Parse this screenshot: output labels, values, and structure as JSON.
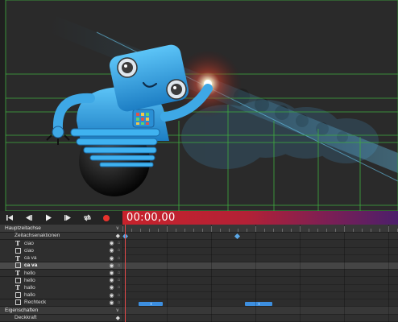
{
  "timecode": "00:00,00",
  "transport": {
    "buttons": [
      "skip-to-start",
      "step-back",
      "play",
      "step-forward",
      "loop",
      "record"
    ]
  },
  "layers_panel": {
    "main_section": "Hauptzeitachse",
    "actions_row": "Zeitachsenaktionen",
    "layers": [
      {
        "type": "text",
        "label": "ciao",
        "selected": false
      },
      {
        "type": "shape",
        "label": "ciao",
        "selected": false
      },
      {
        "type": "text",
        "label": "ca va",
        "selected": false
      },
      {
        "type": "shape",
        "label": "ca va",
        "selected": true
      },
      {
        "type": "text",
        "label": "hello",
        "selected": false
      },
      {
        "type": "shape",
        "label": "hello",
        "selected": false
      },
      {
        "type": "text",
        "label": "hallo",
        "selected": false
      },
      {
        "type": "shape",
        "label": "hallo",
        "selected": false
      },
      {
        "type": "shape",
        "label": "Rechteck",
        "selected": false
      }
    ],
    "properties_section": "Eigenschaften",
    "properties_row": "Deckkraft"
  },
  "icons": {
    "text_layer": "T",
    "shape_layer": "square-outline-icon",
    "eye": "eye-icon",
    "lock": "lock-icon",
    "keyframe": "diamond-icon"
  },
  "colors": {
    "timecode_gradient_start": "#c8222b",
    "timecode_gradient_end": "#4c1f6b",
    "keyframe": "#5ba7e6",
    "clip": "#3d8fe0",
    "record": "#e8332d",
    "guides": "#3fae3f"
  }
}
